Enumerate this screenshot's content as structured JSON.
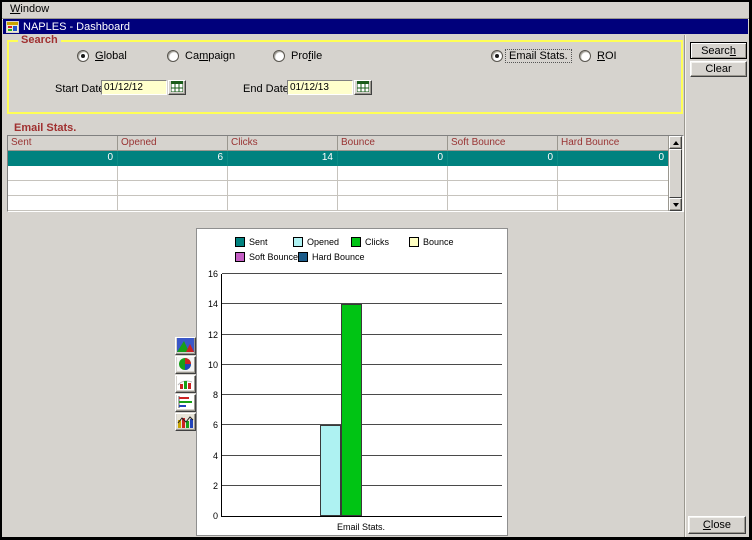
{
  "window": {
    "menu_label": {
      "label": "Window",
      "mnemonic": 0
    },
    "title": "NAPLES - Dashboard"
  },
  "search_panel": {
    "label": "Search",
    "radio_groups": [
      {
        "items": [
          {
            "label": "Global",
            "mnemonic": 0,
            "selected": true,
            "focused": false
          },
          {
            "label": "Campaign",
            "mnemonic": 2,
            "selected": false,
            "focused": false
          },
          {
            "label": "Profile",
            "mnemonic": 3,
            "selected": false,
            "focused": false
          }
        ]
      },
      {
        "items": [
          {
            "label": "Email Stats.",
            "mnemonic": -1,
            "selected": true,
            "focused": true
          },
          {
            "label": "ROI",
            "mnemonic": 0,
            "selected": false,
            "focused": false
          }
        ]
      }
    ],
    "start_date": {
      "label": "Start Date",
      "value": "01/12/12",
      "icon": "calendar-icon"
    },
    "end_date": {
      "label": "End Date",
      "value": "01/12/13",
      "icon": "calendar-icon"
    }
  },
  "actions": {
    "search": {
      "label": "Search",
      "mnemonic": 5
    },
    "clear": {
      "label": "Clear",
      "mnemonic": -1
    },
    "close": {
      "label": "Close",
      "mnemonic": 0
    }
  },
  "table": {
    "caption": "Email Stats.",
    "columns": [
      "Sent",
      "Opened",
      "Clicks",
      "Bounce",
      "Soft Bounce",
      "Hard Bounce"
    ],
    "rows": [
      {
        "cells": [
          "0",
          "6",
          "14",
          "0",
          "0",
          "0"
        ],
        "selected": true
      },
      {
        "cells": [
          "",
          "",
          "",
          "",
          "",
          ""
        ],
        "selected": false
      },
      {
        "cells": [
          "",
          "",
          "",
          "",
          "",
          ""
        ],
        "selected": false
      },
      {
        "cells": [
          "",
          "",
          "",
          "",
          "",
          ""
        ],
        "selected": false
      }
    ]
  },
  "chart_data": {
    "type": "bar",
    "title": "",
    "categories": [
      "Email Stats."
    ],
    "series": [
      {
        "name": "Sent",
        "values": [
          0
        ],
        "color": "#00827f"
      },
      {
        "name": "Opened",
        "values": [
          6
        ],
        "color": "#aef2f2"
      },
      {
        "name": "Clicks",
        "values": [
          14
        ],
        "color": "#00c414"
      },
      {
        "name": "Bounce",
        "values": [
          0
        ],
        "color": "#ffffc2"
      },
      {
        "name": "Soft Bounce",
        "values": [
          0
        ],
        "color": "#c45ec4"
      },
      {
        "name": "Hard Bounce",
        "values": [
          0
        ],
        "color": "#1c5c8a"
      }
    ],
    "xlabel": "Email Stats.",
    "ylabel": "",
    "ylim": [
      0,
      16
    ],
    "ytick_step": 2,
    "grid": true,
    "legend_position": "top"
  },
  "chart_toolbar": {
    "icons": [
      "area-chart-icon",
      "pie-chart-icon",
      "bar-chart-icon",
      "hbar-chart-icon",
      "mixed-chart-icon"
    ]
  },
  "colors": {
    "titlebar": "#00007b",
    "selected_row": "#00827f",
    "group_border_yellow": "#ffff56",
    "caption_red": "#a03030",
    "header_maroon": "#993333",
    "input_bg": "#ffffcc",
    "window_bg": "#d6d3ce"
  }
}
